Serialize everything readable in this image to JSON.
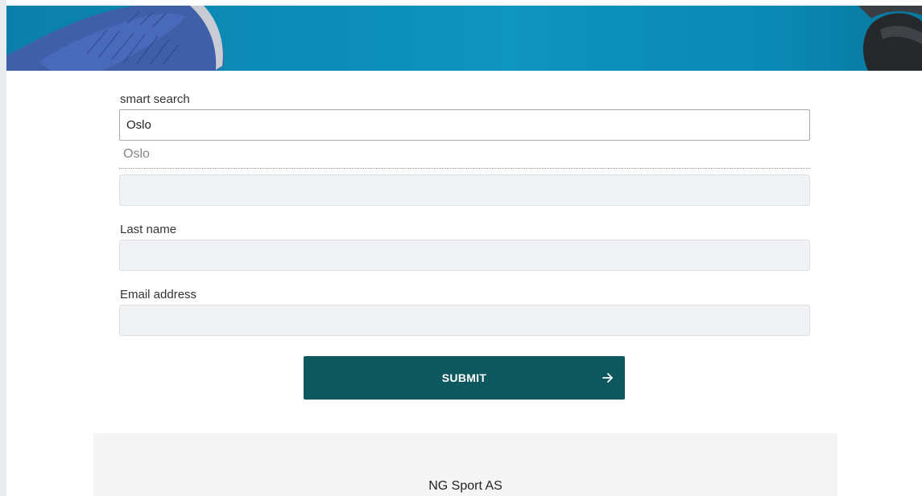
{
  "form": {
    "smart_search_label": "smart search",
    "smart_search_value": "Oslo",
    "suggestion_text": "Oslo",
    "unlabeled_field_value": "",
    "last_name_label": "Last name",
    "last_name_value": "",
    "email_label": "Email address",
    "email_value": "",
    "submit_label": "SUBMIT"
  },
  "footer": {
    "company_name": "NG Sport AS"
  },
  "icons": {
    "submit_arrow": "arrow-right-icon"
  },
  "colors": {
    "hero_blue": "#0e95c0",
    "submit_bg": "#0c585e",
    "input_bg": "#f0f2f4",
    "footer_bg": "#f5f5f5"
  }
}
